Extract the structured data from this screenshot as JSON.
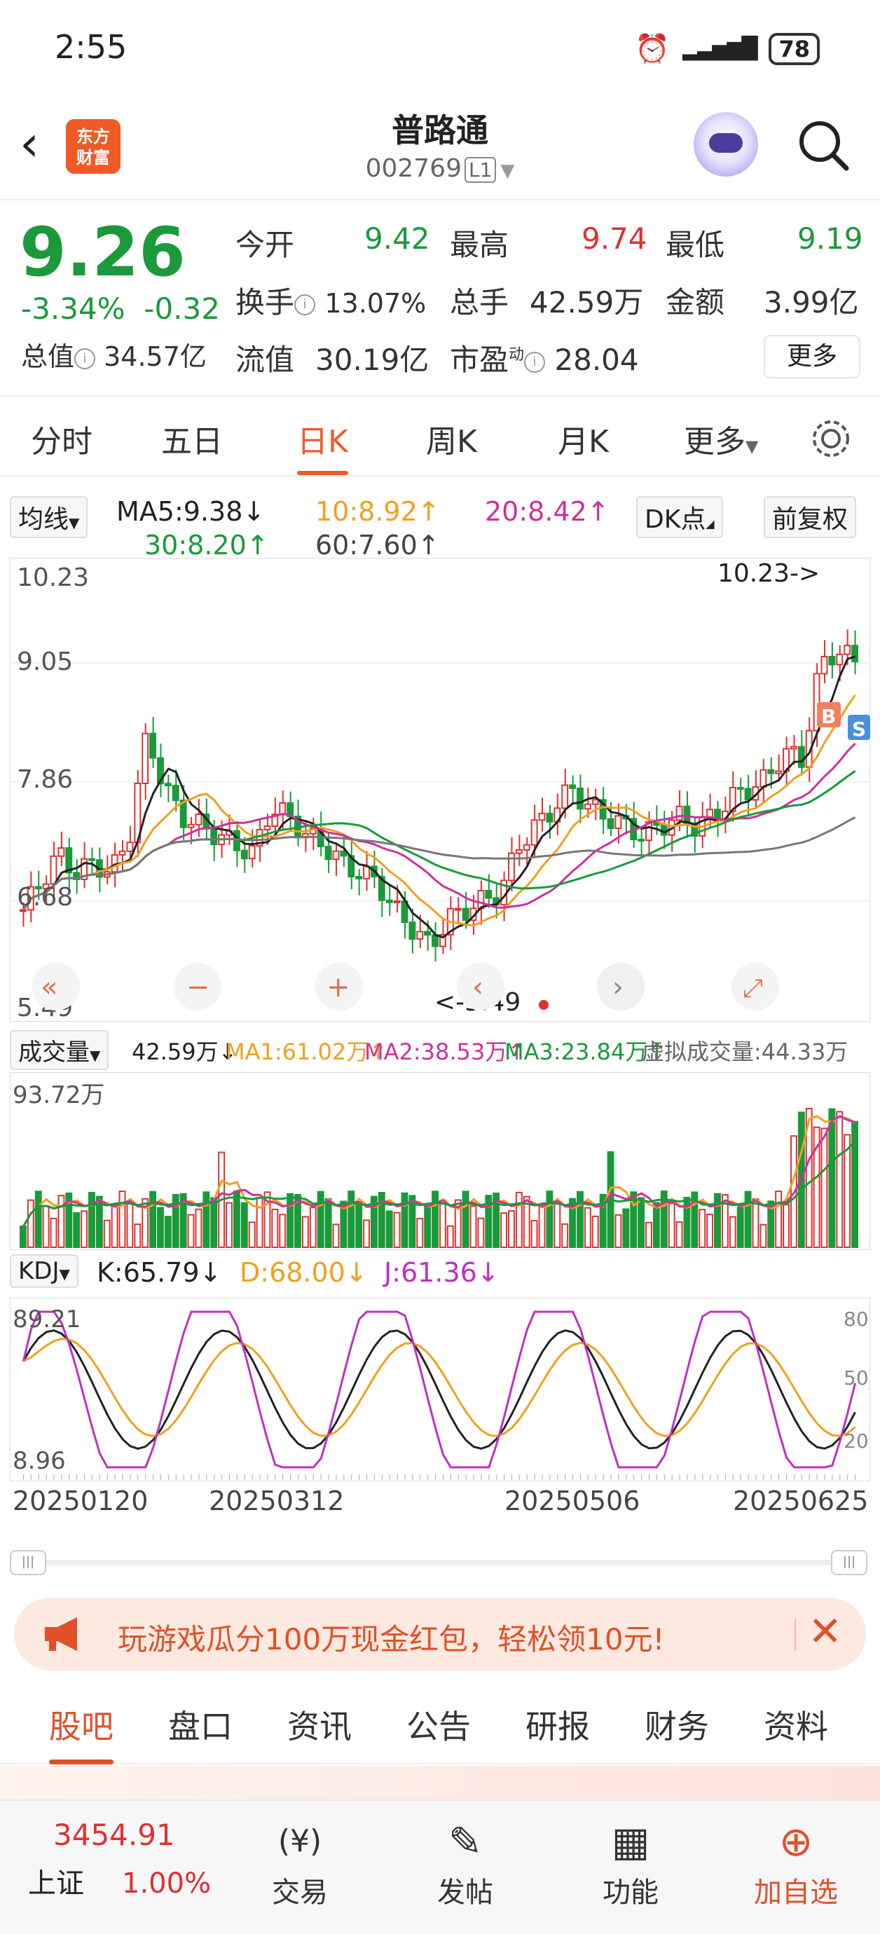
{
  "status": {
    "time": "2:55",
    "battery": "78"
  },
  "header": {
    "app_logo": "东方\n财富",
    "title": "普路通",
    "code": "002769",
    "level": "L1"
  },
  "quote": {
    "price": "9.26",
    "change_pct": "-3.34%",
    "change": "-0.32",
    "open_label": "今开",
    "open": "9.42",
    "high_label": "最高",
    "high": "9.74",
    "low_label": "最低",
    "low": "9.19",
    "turnover_label": "换手",
    "turnover": "13.07%",
    "vol_label": "总手",
    "vol": "42.59万",
    "amount_label": "金额",
    "amount": "3.99亿",
    "mcap_label": "总值",
    "mcap": "34.57亿",
    "float_label": "流值",
    "float": "30.19亿",
    "pe_label": "市盈",
    "pe_sup": "动",
    "pe": "28.04",
    "more": "更多"
  },
  "tabs": [
    "分时",
    "五日",
    "日K",
    "周K",
    "月K",
    "更多"
  ],
  "active_tab": "日K",
  "ma": {
    "selector": "均线",
    "ma5": "MA5:9.38↓",
    "ma10": "10:8.92↑",
    "ma20": "20:8.42↑",
    "ma30": "30:8.20↑",
    "ma60": "60:7.60↑",
    "dk": "DK点",
    "adj": "前复权"
  },
  "chart_labels": {
    "top": "10.23",
    "mid1": "9.05",
    "mid2": "7.86",
    "mid3": "6.68",
    "bottom": "5.49",
    "max_marker": "10.23->",
    "min_marker": "<-5.49",
    "b_marker": "B",
    "s_marker": "S"
  },
  "volume": {
    "selector": "成交量",
    "vol": "42.59万↓",
    "ma1": "MA1:61.02万↑",
    "ma2": "MA2:38.53万↑",
    "ma3": "MA3:23.84万↑",
    "virtual": "虚拟成交量:44.33万",
    "top": "93.72万"
  },
  "kdj": {
    "selector": "KDJ",
    "k": "K:65.79↓",
    "d": "D:68.00↓",
    "j": "J:61.36↓",
    "top": "89.21",
    "bottom": "8.96",
    "r80": "80",
    "r50": "50",
    "r20": "20"
  },
  "dates": [
    "20250120",
    "20250312",
    "20250506",
    "20250625"
  ],
  "banner": {
    "text": "玩游戏瓜分100万现金红包，轻松领10元!"
  },
  "bottom_tabs": [
    "股吧",
    "盘口",
    "资讯",
    "公告",
    "研报",
    "财务",
    "资料"
  ],
  "nav": {
    "index_value": "3454.91",
    "index_name": "上证",
    "index_pct": "1.00%",
    "trade": "交易",
    "post": "发帖",
    "func": "功能",
    "add": "加自选"
  },
  "colors": {
    "accent": "#ef5a26",
    "up": "#e03030",
    "down": "#1a9a3a",
    "ma5": "#222222",
    "ma10": "#f0a020",
    "ma20": "#d0309a",
    "ma30": "#1a9a3a",
    "ma60": "#777777"
  }
}
